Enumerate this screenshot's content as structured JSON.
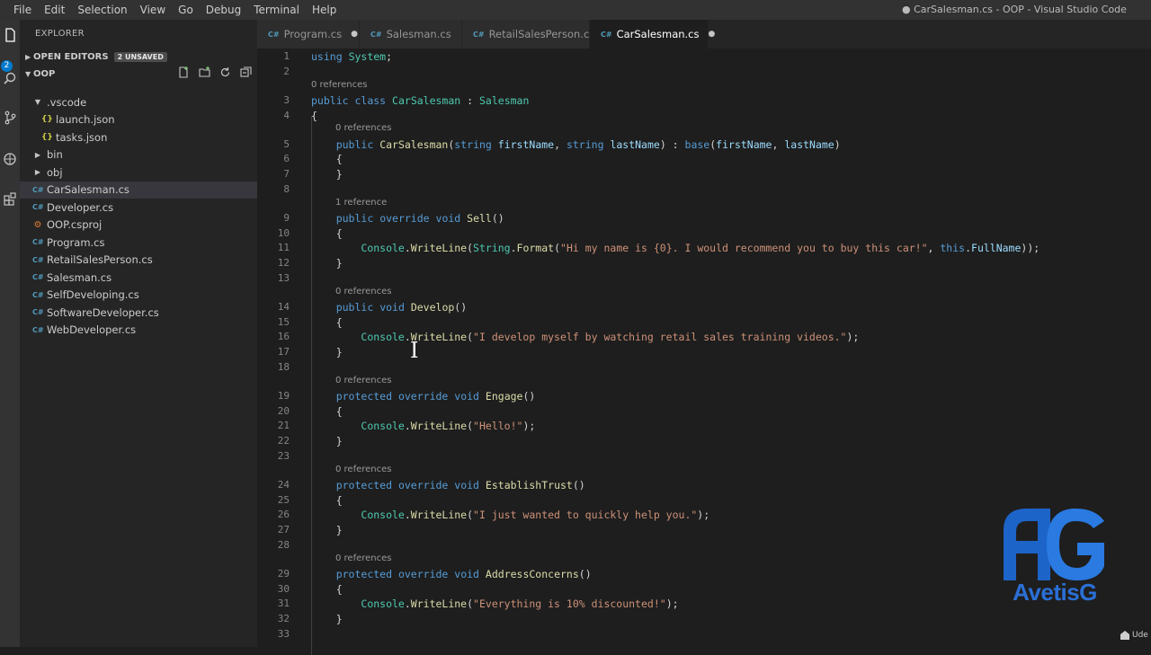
{
  "window": {
    "title": "● CarSalesman.cs - OOP - Visual Studio Code",
    "menu": [
      "File",
      "Edit",
      "Selection",
      "View",
      "Go",
      "Debug",
      "Terminal",
      "Help"
    ]
  },
  "activity_bar": {
    "badge": "2",
    "icons": [
      "files-icon",
      "search-icon",
      "source-control-icon",
      "debug-icon",
      "extensions-icon"
    ]
  },
  "sidebar": {
    "title": "EXPLORER",
    "open_editors": {
      "label": "OPEN EDITORS",
      "badge": "2 UNSAVED"
    },
    "folder": {
      "label": "OOP"
    },
    "items": [
      {
        "label": ".vscode",
        "icon": "chevron-down",
        "depth": 1
      },
      {
        "label": "launch.json",
        "icon": "json",
        "depth": 2
      },
      {
        "label": "tasks.json",
        "icon": "json",
        "depth": 2
      },
      {
        "label": "bin",
        "icon": "chevron-right",
        "depth": 1
      },
      {
        "label": "obj",
        "icon": "chevron-right",
        "depth": 1
      },
      {
        "label": "CarSalesman.cs",
        "icon": "cs",
        "depth": 1,
        "selected": true
      },
      {
        "label": "Developer.cs",
        "icon": "cs",
        "depth": 1
      },
      {
        "label": "OOP.csproj",
        "icon": "csproj",
        "depth": 1
      },
      {
        "label": "Program.cs",
        "icon": "cs",
        "depth": 1
      },
      {
        "label": "RetailSalesPerson.cs",
        "icon": "cs",
        "depth": 1
      },
      {
        "label": "Salesman.cs",
        "icon": "cs",
        "depth": 1
      },
      {
        "label": "SelfDeveloping.cs",
        "icon": "cs",
        "depth": 1
      },
      {
        "label": "SoftwareDeveloper.cs",
        "icon": "cs",
        "depth": 1
      },
      {
        "label": "WebDeveloper.cs",
        "icon": "cs",
        "depth": 1
      }
    ]
  },
  "tabs": [
    {
      "label": "Program.cs",
      "dirty": true,
      "active": false
    },
    {
      "label": "Salesman.cs",
      "dirty": false,
      "active": false
    },
    {
      "label": "RetailSalesPerson.cs",
      "dirty": false,
      "active": false
    },
    {
      "label": "CarSalesman.cs",
      "dirty": true,
      "active": true
    }
  ],
  "editor": {
    "lines": [
      {
        "n": 1,
        "t": [
          [
            "kw",
            "using"
          ],
          [
            "pl",
            " "
          ],
          [
            "ty",
            "System"
          ],
          [
            "pl",
            ";"
          ]
        ]
      },
      {
        "n": 2,
        "t": []
      },
      {
        "lens": "0 references",
        "indent": 0
      },
      {
        "n": 3,
        "t": [
          [
            "kw",
            "public"
          ],
          [
            "pl",
            " "
          ],
          [
            "kw",
            "class"
          ],
          [
            "pl",
            " "
          ],
          [
            "ty",
            "CarSalesman"
          ],
          [
            "pl",
            " : "
          ],
          [
            "ty",
            "Salesman"
          ]
        ]
      },
      {
        "n": 4,
        "t": [
          [
            "pl",
            "{"
          ]
        ]
      },
      {
        "lens": "0 references",
        "indent": 1
      },
      {
        "n": 5,
        "t": [
          [
            "pl",
            "    "
          ],
          [
            "kw",
            "public"
          ],
          [
            "pl",
            " "
          ],
          [
            "fn",
            "CarSalesman"
          ],
          [
            "pl",
            "("
          ],
          [
            "kw",
            "string"
          ],
          [
            "pl",
            " "
          ],
          [
            "id",
            "firstName"
          ],
          [
            "pl",
            ", "
          ],
          [
            "kw",
            "string"
          ],
          [
            "pl",
            " "
          ],
          [
            "id",
            "lastName"
          ],
          [
            "pl",
            ") : "
          ],
          [
            "kw",
            "base"
          ],
          [
            "pl",
            "("
          ],
          [
            "id",
            "firstName"
          ],
          [
            "pl",
            ", "
          ],
          [
            "id",
            "lastName"
          ],
          [
            "pl",
            ")"
          ]
        ]
      },
      {
        "n": 6,
        "t": [
          [
            "pl",
            "    {"
          ]
        ]
      },
      {
        "n": 7,
        "t": [
          [
            "pl",
            "    }"
          ]
        ]
      },
      {
        "n": 8,
        "t": []
      },
      {
        "lens": "1 reference",
        "indent": 1
      },
      {
        "n": 9,
        "t": [
          [
            "pl",
            "    "
          ],
          [
            "kw",
            "public"
          ],
          [
            "pl",
            " "
          ],
          [
            "kw",
            "override"
          ],
          [
            "pl",
            " "
          ],
          [
            "kw",
            "void"
          ],
          [
            "pl",
            " "
          ],
          [
            "fn",
            "Sell"
          ],
          [
            "pl",
            "()"
          ]
        ]
      },
      {
        "n": 10,
        "t": [
          [
            "pl",
            "    {"
          ]
        ]
      },
      {
        "n": 11,
        "t": [
          [
            "pl",
            "        "
          ],
          [
            "ty",
            "Console"
          ],
          [
            "pl",
            "."
          ],
          [
            "fn",
            "WriteLine"
          ],
          [
            "pl",
            "("
          ],
          [
            "ty",
            "String"
          ],
          [
            "pl",
            "."
          ],
          [
            "fn",
            "Format"
          ],
          [
            "pl",
            "("
          ],
          [
            "str",
            "\"Hi my name is {0}. I would recommend you to buy this car!\""
          ],
          [
            "pl",
            ", "
          ],
          [
            "kw",
            "this"
          ],
          [
            "pl",
            "."
          ],
          [
            "id",
            "FullName"
          ],
          [
            "pl",
            "));"
          ]
        ]
      },
      {
        "n": 12,
        "t": [
          [
            "pl",
            "    }"
          ]
        ]
      },
      {
        "n": 13,
        "t": []
      },
      {
        "lens": "0 references",
        "indent": 1
      },
      {
        "n": 14,
        "t": [
          [
            "pl",
            "    "
          ],
          [
            "kw",
            "public"
          ],
          [
            "pl",
            " "
          ],
          [
            "kw",
            "void"
          ],
          [
            "pl",
            " "
          ],
          [
            "fn",
            "Develop"
          ],
          [
            "pl",
            "()"
          ]
        ]
      },
      {
        "n": 15,
        "t": [
          [
            "pl",
            "    {"
          ]
        ]
      },
      {
        "n": 16,
        "t": [
          [
            "pl",
            "        "
          ],
          [
            "ty",
            "Console"
          ],
          [
            "pl",
            "."
          ],
          [
            "fn",
            "WriteLine"
          ],
          [
            "pl",
            "("
          ],
          [
            "str",
            "\"I develop myself by watching retail sales training videos.\""
          ],
          [
            "pl",
            ");"
          ]
        ]
      },
      {
        "n": 17,
        "t": [
          [
            "pl",
            "    }"
          ]
        ]
      },
      {
        "n": 18,
        "t": []
      },
      {
        "lens": "0 references",
        "indent": 1
      },
      {
        "n": 19,
        "t": [
          [
            "pl",
            "    "
          ],
          [
            "kw",
            "protected"
          ],
          [
            "pl",
            " "
          ],
          [
            "kw",
            "override"
          ],
          [
            "pl",
            " "
          ],
          [
            "kw",
            "void"
          ],
          [
            "pl",
            " "
          ],
          [
            "fn",
            "Engage"
          ],
          [
            "pl",
            "()"
          ]
        ]
      },
      {
        "n": 20,
        "t": [
          [
            "pl",
            "    {"
          ]
        ]
      },
      {
        "n": 21,
        "t": [
          [
            "pl",
            "        "
          ],
          [
            "ty",
            "Console"
          ],
          [
            "pl",
            "."
          ],
          [
            "fn",
            "WriteLine"
          ],
          [
            "pl",
            "("
          ],
          [
            "str",
            "\"Hello!\""
          ],
          [
            "pl",
            ");"
          ]
        ]
      },
      {
        "n": 22,
        "t": [
          [
            "pl",
            "    }"
          ]
        ]
      },
      {
        "n": 23,
        "t": []
      },
      {
        "lens": "0 references",
        "indent": 1
      },
      {
        "n": 24,
        "t": [
          [
            "pl",
            "    "
          ],
          [
            "kw",
            "protected"
          ],
          [
            "pl",
            " "
          ],
          [
            "kw",
            "override"
          ],
          [
            "pl",
            " "
          ],
          [
            "kw",
            "void"
          ],
          [
            "pl",
            " "
          ],
          [
            "fn",
            "EstablishTrust"
          ],
          [
            "pl",
            "()"
          ]
        ]
      },
      {
        "n": 25,
        "t": [
          [
            "pl",
            "    {"
          ]
        ]
      },
      {
        "n": 26,
        "t": [
          [
            "pl",
            "        "
          ],
          [
            "ty",
            "Console"
          ],
          [
            "pl",
            "."
          ],
          [
            "fn",
            "WriteLine"
          ],
          [
            "pl",
            "("
          ],
          [
            "str",
            "\"I just wanted to quickly help you.\""
          ],
          [
            "pl",
            ");"
          ]
        ]
      },
      {
        "n": 27,
        "t": [
          [
            "pl",
            "    }"
          ]
        ]
      },
      {
        "n": 28,
        "t": []
      },
      {
        "lens": "0 references",
        "indent": 1
      },
      {
        "n": 29,
        "t": [
          [
            "pl",
            "    "
          ],
          [
            "kw",
            "protected"
          ],
          [
            "pl",
            " "
          ],
          [
            "kw",
            "override"
          ],
          [
            "pl",
            " "
          ],
          [
            "kw",
            "void"
          ],
          [
            "pl",
            " "
          ],
          [
            "fn",
            "AddressConcerns"
          ],
          [
            "pl",
            "()"
          ]
        ]
      },
      {
        "n": 30,
        "t": [
          [
            "pl",
            "    {"
          ]
        ]
      },
      {
        "n": 31,
        "t": [
          [
            "pl",
            "        "
          ],
          [
            "ty",
            "Console"
          ],
          [
            "pl",
            "."
          ],
          [
            "fn",
            "WriteLine"
          ],
          [
            "pl",
            "("
          ],
          [
            "str",
            "\"Everything is 10% discounted!\""
          ],
          [
            "pl",
            ");"
          ]
        ]
      },
      {
        "n": 32,
        "t": [
          [
            "pl",
            "    }"
          ]
        ]
      },
      {
        "n": 33,
        "t": []
      }
    ]
  },
  "watermark": {
    "text": "AvetisG",
    "monogram": "AG"
  },
  "corner_text": "Ude"
}
